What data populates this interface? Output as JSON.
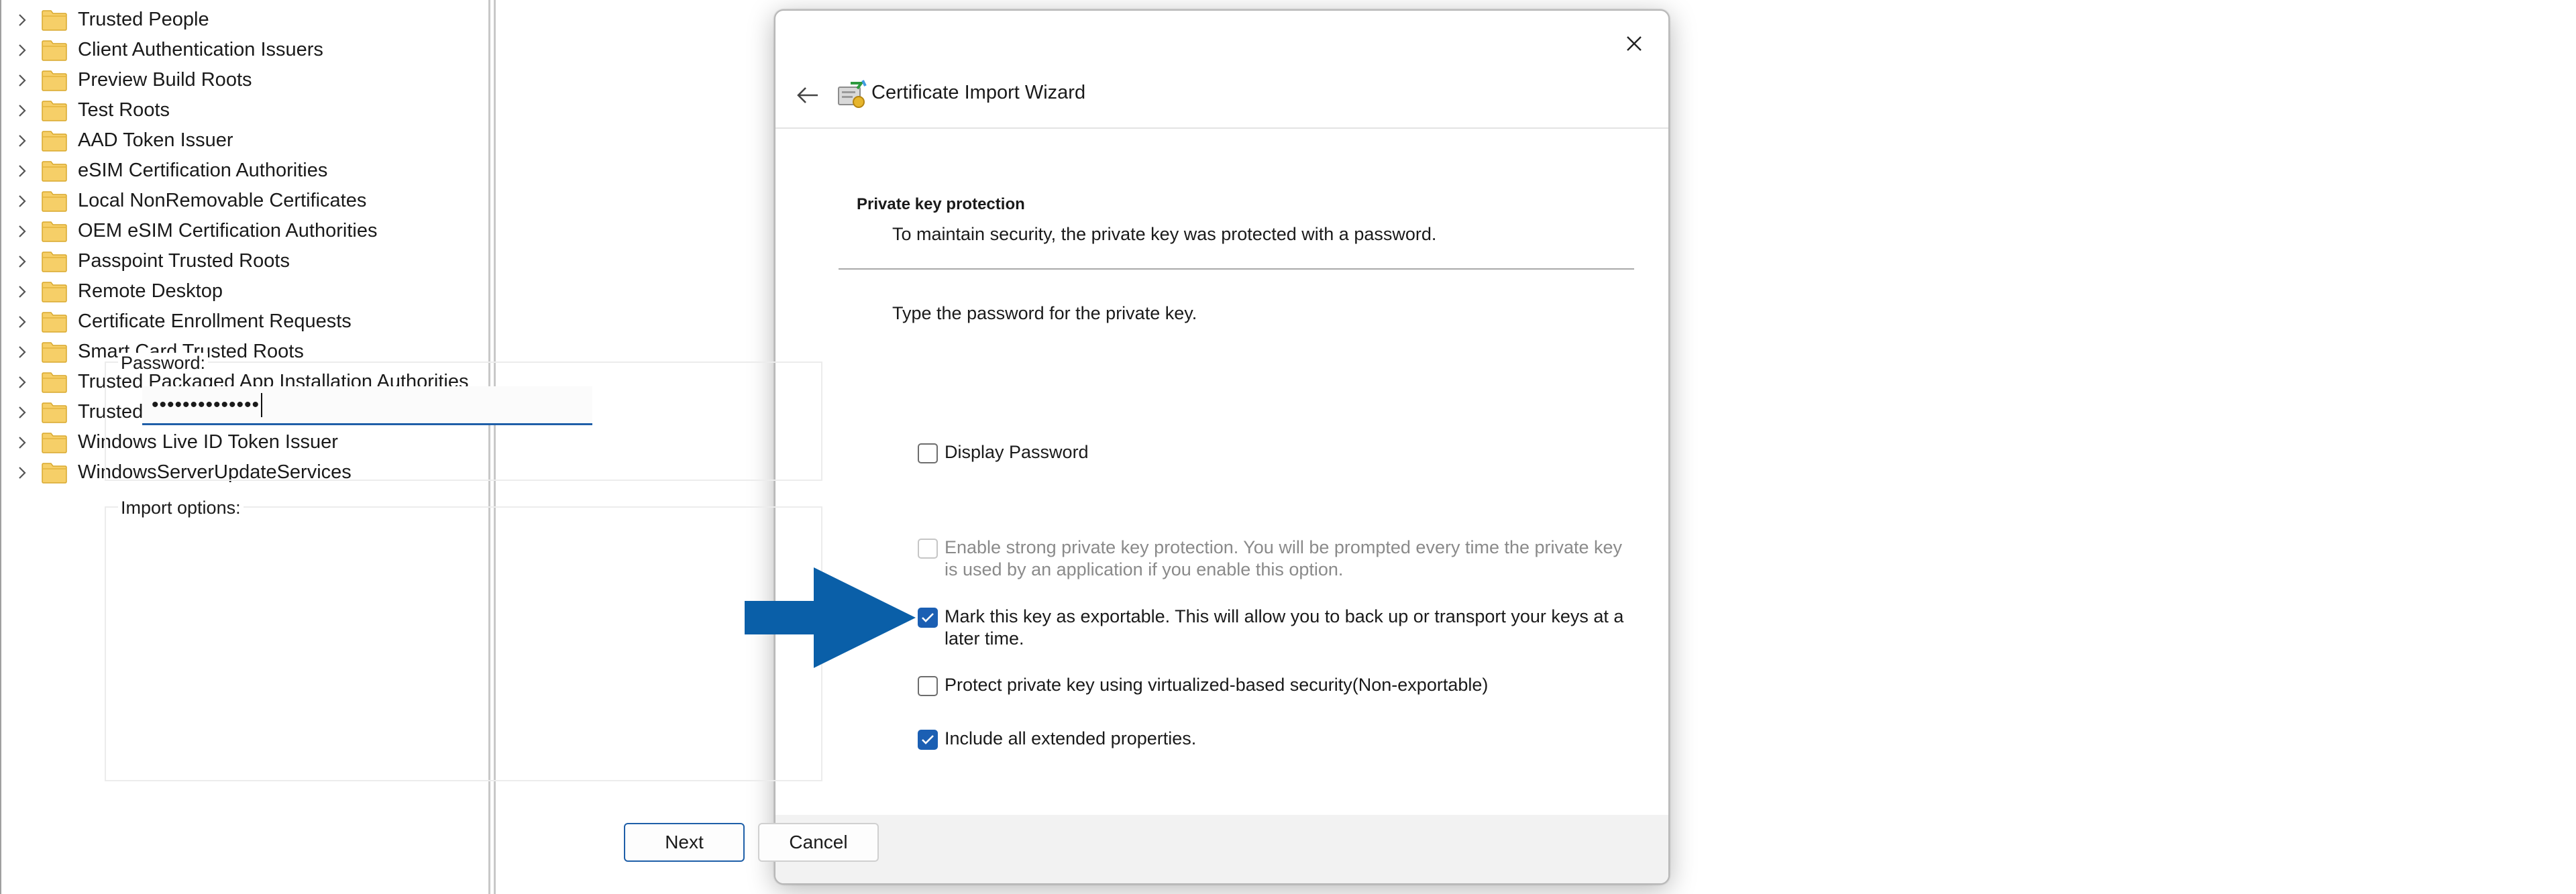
{
  "tree": {
    "items": [
      {
        "label": "Trusted People"
      },
      {
        "label": "Client Authentication Issuers"
      },
      {
        "label": "Preview Build Roots"
      },
      {
        "label": "Test Roots"
      },
      {
        "label": "AAD Token Issuer"
      },
      {
        "label": "eSIM Certification Authorities"
      },
      {
        "label": "Local NonRemovable Certificates"
      },
      {
        "label": "OEM eSIM Certification Authorities"
      },
      {
        "label": "Passpoint Trusted Roots"
      },
      {
        "label": "Remote Desktop"
      },
      {
        "label": "Certificate Enrollment Requests"
      },
      {
        "label": "Smart Card Trusted Roots"
      },
      {
        "label": "Trusted Packaged App Installation Authorities"
      },
      {
        "label": "Trusted Devices"
      },
      {
        "label": "Windows Live ID Token Issuer"
      },
      {
        "label": "WindowsServerUpdateServices"
      }
    ]
  },
  "dialog": {
    "title": "Certificate Import Wizard",
    "section_title": "Private key protection",
    "section_desc": "To maintain security, the private key was protected with a password.",
    "instruction": "Type the password for the private key.",
    "password": {
      "label": "Password:",
      "value": "••••••••••••••"
    },
    "display_password": {
      "label": "Display Password",
      "checked": false
    },
    "import_options": {
      "label": "Import options:",
      "options": [
        {
          "line1": "Enable strong private key protection. You will be prompted every time the private key",
          "line2": "is used by an application if you enable this option.",
          "checked": false,
          "disabled": true
        },
        {
          "line1": "Mark this key as exportable. This will allow you to back up or transport your keys at a",
          "line2": "later time.",
          "checked": true,
          "disabled": false
        },
        {
          "line1": "Protect private key using virtualized-based security(Non-exportable)",
          "checked": false,
          "disabled": false
        },
        {
          "line1": "Include all extended properties.",
          "checked": true,
          "disabled": false
        }
      ]
    },
    "buttons": {
      "next": "Next",
      "cancel": "Cancel"
    }
  },
  "colors": {
    "accent": "#1b5fb3",
    "arrow": "#0a5fa8",
    "folder": "#f2c14e"
  }
}
